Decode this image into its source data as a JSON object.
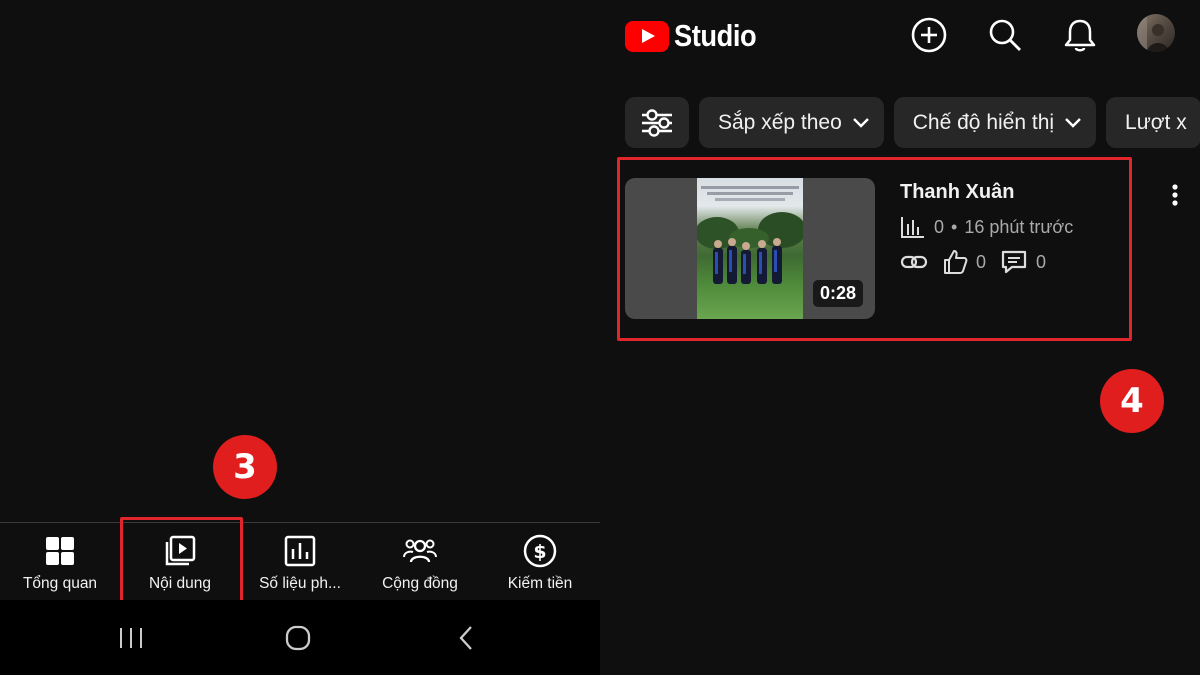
{
  "bottom_nav": {
    "items": [
      {
        "label": "Tổng quan",
        "icon": "dashboard-icon"
      },
      {
        "label": "Nội dung",
        "icon": "content-icon"
      },
      {
        "label": "Số liệu ph...",
        "icon": "analytics-icon"
      },
      {
        "label": "Cộng đồng",
        "icon": "community-icon"
      },
      {
        "label": "Kiếm tiền",
        "icon": "earn-icon"
      }
    ]
  },
  "system_nav": {
    "recent": "recent-apps-icon",
    "home": "home-icon",
    "back": "back-icon"
  },
  "annotations": {
    "step3": "3",
    "step4": "4",
    "highlight_color": "#e0262b"
  },
  "header": {
    "logo_text": "Studio",
    "brand_color": "#ff0000",
    "icons": [
      "create-icon",
      "search-icon",
      "notifications-icon",
      "avatar"
    ]
  },
  "filters": {
    "chips": [
      {
        "label": "Sắp xếp theo"
      },
      {
        "label": "Chế độ hiển thị"
      },
      {
        "label": "Lượt x"
      }
    ]
  },
  "video": {
    "title": "Thanh Xuân",
    "views": "0",
    "separator": "•",
    "time_ago": "16 phút trước",
    "likes": "0",
    "comments": "0",
    "duration": "0:28"
  }
}
